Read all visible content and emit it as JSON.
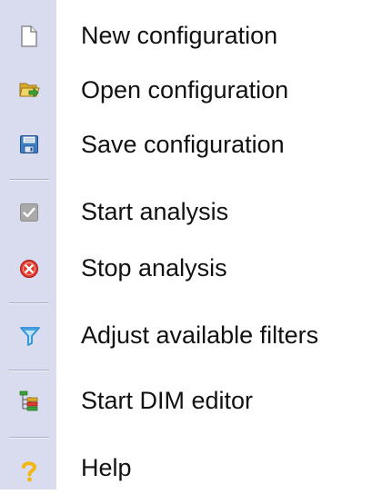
{
  "menu": {
    "items": [
      {
        "label": "New configuration",
        "icon": "new-document-icon"
      },
      {
        "label": "Open configuration",
        "icon": "open-folder-icon"
      },
      {
        "label": "Save configuration",
        "icon": "save-disk-icon"
      },
      {
        "label": "Start analysis",
        "icon": "checkbox-icon"
      },
      {
        "label": "Stop analysis",
        "icon": "stop-icon"
      },
      {
        "label": "Adjust available filters",
        "icon": "filter-funnel-icon"
      },
      {
        "label": "Start DIM editor",
        "icon": "tree-hierarchy-icon"
      },
      {
        "label": "Help",
        "icon": "help-question-icon"
      }
    ]
  },
  "colors": {
    "gutter": "#d9dcef",
    "text": "#111111",
    "separator": "#a8acc4",
    "stop_red": "#e23a2e",
    "filter_blue": "#2a8fd8",
    "help_yellow": "#f2b713",
    "folder_yellow": "#e9c64d",
    "arrow_green": "#3aa13a"
  }
}
